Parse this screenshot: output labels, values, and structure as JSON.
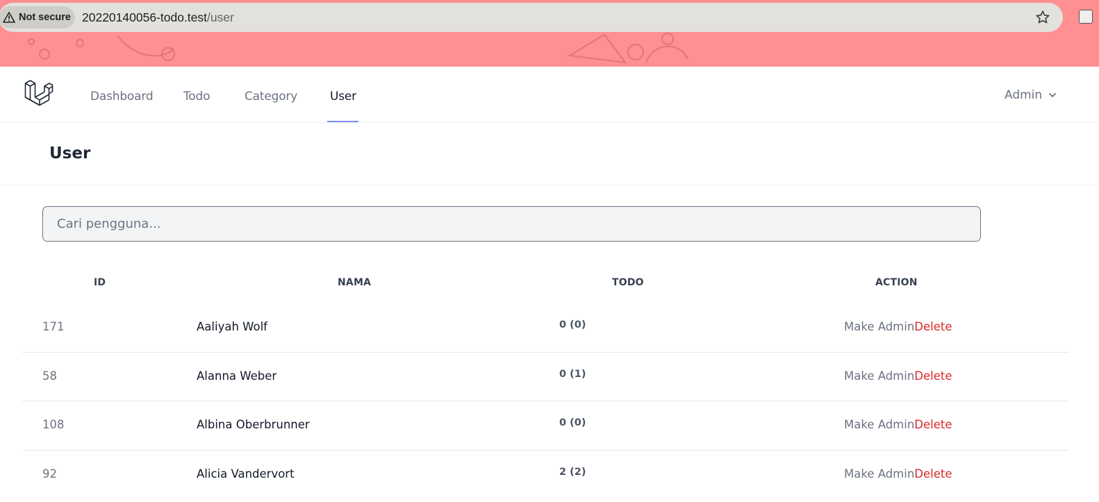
{
  "browser": {
    "security_label": "Not secure",
    "url_host": "20220140056-todo.test",
    "url_path": "/user",
    "accent_color": "#ff8f91"
  },
  "nav": {
    "logo": "laravel-logo-icon",
    "links": [
      {
        "label": "Dashboard",
        "active": false
      },
      {
        "label": "Todo",
        "active": false
      },
      {
        "label": "Category",
        "active": false
      },
      {
        "label": "User",
        "active": true
      }
    ],
    "user_menu": "Admin"
  },
  "header": {
    "title": "User"
  },
  "search": {
    "placeholder": "Cari pengguna..."
  },
  "table": {
    "columns": [
      "ID",
      "NAMA",
      "TODO",
      "ACTION"
    ],
    "rows": [
      {
        "id": "171",
        "name": "Aaliyah Wolf",
        "todo": "0 (0)",
        "make_admin": "Make Admin",
        "delete": "Delete"
      },
      {
        "id": "58",
        "name": "Alanna Weber",
        "todo": "0 (1)",
        "make_admin": "Make Admin",
        "delete": "Delete"
      },
      {
        "id": "108",
        "name": "Albina Oberbrunner",
        "todo": "0 (0)",
        "make_admin": "Make Admin",
        "delete": "Delete"
      },
      {
        "id": "92",
        "name": "Alicia Vandervort",
        "todo": "2 (2)",
        "make_admin": "Make Admin",
        "delete": "Delete"
      }
    ]
  },
  "colors": {
    "delete": "#dc2626",
    "active_underline": "#818cf8"
  }
}
